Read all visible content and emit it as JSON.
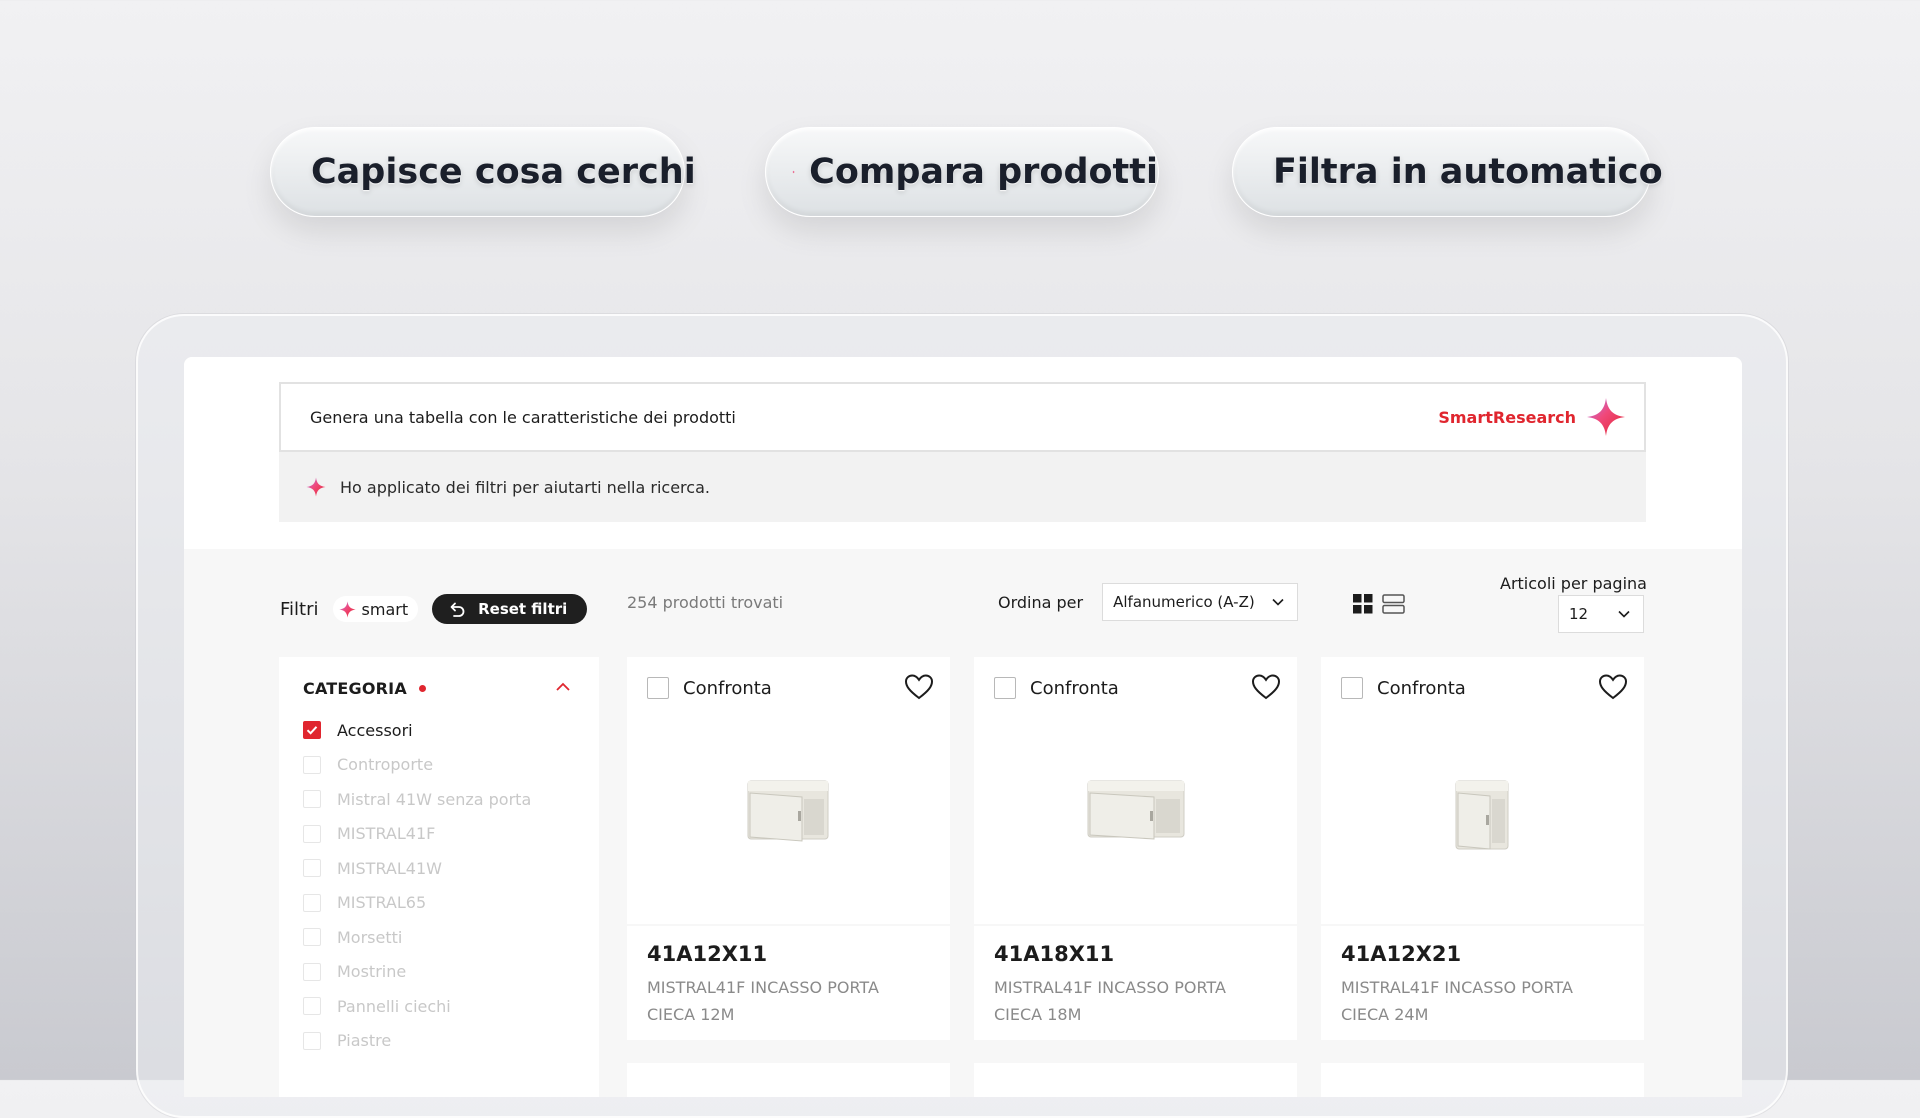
{
  "features": [
    {
      "label": "Capisce cosa cerchi",
      "icon": "sparkle-icon"
    },
    {
      "label": "Compara prodotti",
      "icon": "sparkle-icon"
    },
    {
      "label": "Filtra in automatico",
      "icon": "sparkle-icon"
    }
  ],
  "search": {
    "query": "Genera una tabella con le caratteristiche dei prodotti",
    "brand_label": "SmartResearch",
    "assistant_message": "Ho applicato dei filtri per aiutarti nella ricerca."
  },
  "toolbar": {
    "filters_label": "Filtri",
    "smart_chip": "smart",
    "reset_label": "Reset filtri",
    "results_count": "254 prodotti trovati",
    "order_label": "Ordina per",
    "order_value": "Alfanumerico (A-Z)",
    "per_page_label": "Articoli per pagina",
    "per_page_value": "12"
  },
  "sidebar": {
    "title": "CATEGORIA",
    "items": [
      {
        "label": "Accessori",
        "checked": true
      },
      {
        "label": "Controporte",
        "checked": false
      },
      {
        "label": "Mistral 41W senza porta",
        "checked": false
      },
      {
        "label": "MISTRAL41F",
        "checked": false
      },
      {
        "label": "MISTRAL41W",
        "checked": false
      },
      {
        "label": "MISTRAL65",
        "checked": false
      },
      {
        "label": "Morsetti",
        "checked": false
      },
      {
        "label": "Mostrine",
        "checked": false
      },
      {
        "label": "Pannelli ciechi",
        "checked": false
      },
      {
        "label": "Piastre",
        "checked": false
      }
    ]
  },
  "products": [
    {
      "compare_label": "Confronta",
      "code": "41A12X11",
      "description": "MISTRAL41F INCASSO PORTA CIECA 12M"
    },
    {
      "compare_label": "Confronta",
      "code": "41A18X11",
      "description": "MISTRAL41F INCASSO PORTA CIECA 18M"
    },
    {
      "compare_label": "Confronta",
      "code": "41A12X21",
      "description": "MISTRAL41F INCASSO PORTA CIECA 24M"
    }
  ],
  "colors": {
    "accent": "#e0262f",
    "dark": "#1f1f1f",
    "muted_text": "#8a8a8a"
  }
}
